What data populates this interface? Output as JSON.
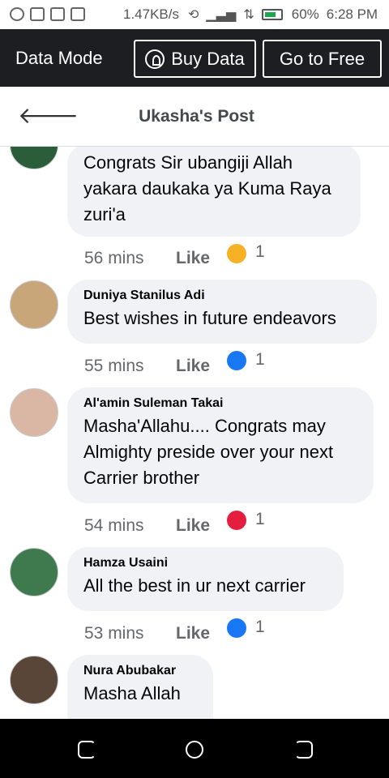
{
  "status_bar": {
    "speed": "1.47KB/s",
    "battery": "60%",
    "time": "6:28 PM",
    "icons": [
      "upload-icon",
      "mail-icon",
      "screen-icon",
      "pulse-icon",
      "rotate-icon",
      "signal-icon",
      "wifi-icon",
      "battery-icon"
    ]
  },
  "data_bar": {
    "mode_label": "Data Mode",
    "buy_label": "Buy Data",
    "free_label": "Go to Free",
    "bg_color": "#1c1e21"
  },
  "header": {
    "title": "Ukasha's Post"
  },
  "comments": [
    {
      "author": "",
      "text": "Congrats Sir ubangiji Allah yakara daukaka ya Kuma Raya zuri'a",
      "time": "56 mins",
      "like": "Like",
      "reaction": "haha-icon",
      "reaction_color": "#f7b125",
      "count": "1"
    },
    {
      "author": "Duniya Stanilus Adi",
      "text": "Best wishes in future endeavors",
      "time": "55 mins",
      "like": "Like",
      "reaction": "like-icon",
      "reaction_color": "#1877f2",
      "count": "1"
    },
    {
      "author": "Al'amin Suleman Takai",
      "text": "Masha'Allahu.... Congrats may Almighty preside over your next Carrier brother",
      "time": "54 mins",
      "like": "Like",
      "reaction": "love-icon",
      "reaction_color": "#e41e3f",
      "count": "1"
    },
    {
      "author": "Hamza Usaini",
      "text": "All the best in ur next carrier",
      "time": "53 mins",
      "like": "Like",
      "reaction": "like-icon",
      "reaction_color": "#1877f2",
      "count": "1"
    },
    {
      "author": "Nura Abubakar",
      "text": "Masha Allah"
    }
  ]
}
